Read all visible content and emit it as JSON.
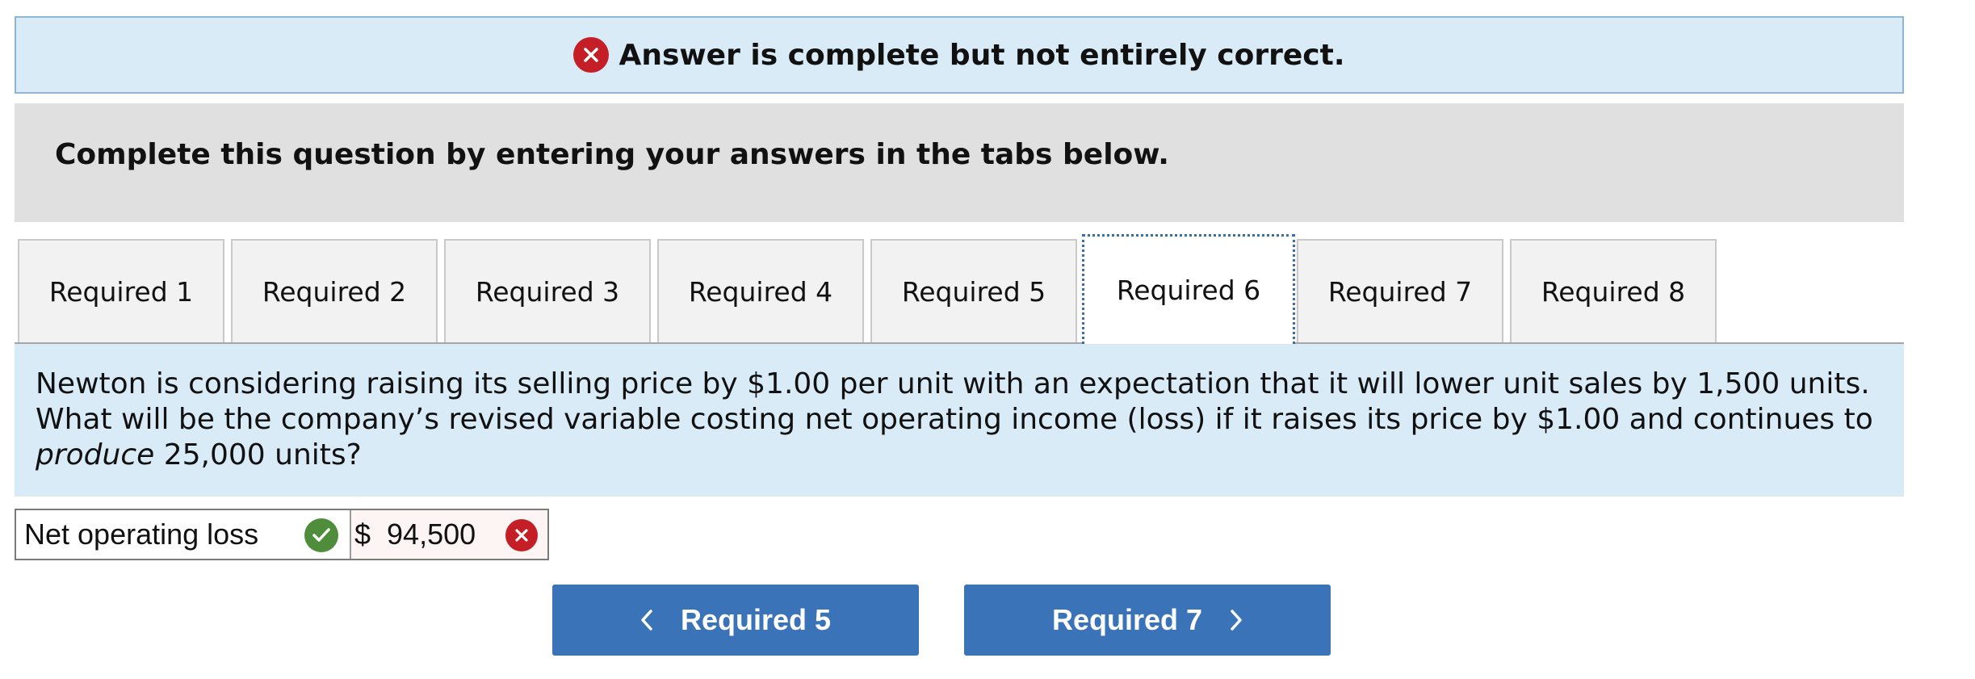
{
  "alert": {
    "message": "Answer is complete but not entirely correct."
  },
  "instruction": "Complete this question by entering your answers in the tabs below.",
  "tabs": [
    {
      "label": "Required 1"
    },
    {
      "label": "Required 2"
    },
    {
      "label": "Required 3"
    },
    {
      "label": "Required 4"
    },
    {
      "label": "Required 5"
    },
    {
      "label": "Required 6",
      "active": true
    },
    {
      "label": "Required 7"
    },
    {
      "label": "Required 8"
    }
  ],
  "question": {
    "line1": "Newton is considering raising its selling price by $1.00 per unit with an expectation that it will lower unit sales by 1,500 units.",
    "line2": "What will be the company’s revised variable costing net operating income (loss) if it raises its price by $1.00 and continues to",
    "line3_emphasis": "produce",
    "line3_rest": " 25,000 units?"
  },
  "answer": {
    "label": "Net operating loss",
    "currency": "$",
    "value": "94,500",
    "label_status": "correct",
    "value_status": "incorrect"
  },
  "navigation": {
    "prev_label": "Required 5",
    "next_label": "Required 7"
  },
  "colors": {
    "alert_bg": "#daebf8",
    "error_red": "#c41f26",
    "success_green": "#4f8d3d",
    "button_blue": "#3b73b9"
  }
}
